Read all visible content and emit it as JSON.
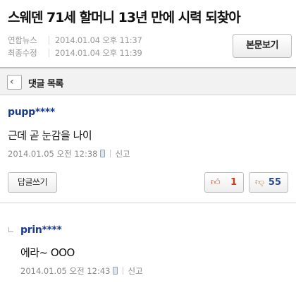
{
  "article": {
    "headline": "스웨덴 71세 할머니 13년 만에 시력 되찾아",
    "source": "연합뉴스",
    "published_at": "2014.01.04 오후 11:37",
    "modified_label": "최종수정",
    "modified_at": "2014.01.04 오후 11:39",
    "view_article_button": "본문보기"
  },
  "comment_list": {
    "back_icon": "chevron-left-icon",
    "title": "댓글 목록"
  },
  "comments": [
    {
      "user": "pupp****",
      "text": "근데 곧 눈감을 나이",
      "timestamp": "2014.01.05 오전 12:38",
      "device_icon": "mobile-icon",
      "report_label": "신고",
      "reply_button": "답글쓰기",
      "like_icon": "thumbs-up-icon",
      "likes": "1",
      "dislike_icon": "thumbs-down-icon",
      "dislikes": "55"
    },
    {
      "user": "prin****",
      "text": "에라~ OOO",
      "timestamp": "2014.01.05 오전 12:43",
      "device_icon": "mobile-icon",
      "report_label": "신고"
    }
  ]
}
